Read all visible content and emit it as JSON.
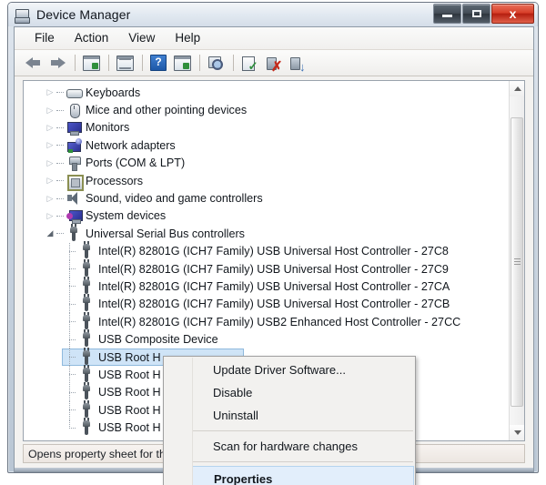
{
  "window": {
    "title": "Device Manager",
    "icon": "device-manager-icon",
    "buttons": {
      "minimize": "–",
      "maximize": "□",
      "close": "x"
    }
  },
  "menubar": {
    "items": [
      {
        "label": "File"
      },
      {
        "label": "Action"
      },
      {
        "label": "View"
      },
      {
        "label": "Help"
      }
    ]
  },
  "toolbar": {
    "items": [
      {
        "name": "back-icon",
        "type": "arrow-left"
      },
      {
        "name": "forward-icon",
        "type": "arrow-right"
      },
      {
        "name": "separator-1",
        "type": "separator"
      },
      {
        "name": "show-hidden-devices-icon",
        "type": "panel-green"
      },
      {
        "name": "separator-2",
        "type": "separator"
      },
      {
        "name": "properties-icon",
        "type": "panel-lines"
      },
      {
        "name": "separator-3",
        "type": "separator"
      },
      {
        "name": "help-icon",
        "type": "help",
        "glyph": "?"
      },
      {
        "name": "view-panel-icon",
        "type": "panel-green2"
      },
      {
        "name": "separator-4",
        "type": "separator"
      },
      {
        "name": "scan-for-hardware-changes-icon",
        "type": "scan"
      },
      {
        "name": "separator-5",
        "type": "separator"
      },
      {
        "name": "update-driver-icon",
        "type": "driver-check"
      },
      {
        "name": "disable-device-icon",
        "type": "driver-x"
      },
      {
        "name": "enable-device-icon",
        "type": "driver-down"
      }
    ]
  },
  "tree": {
    "nodes": [
      {
        "label": "Keyboards",
        "icon": "keyboard-icon",
        "level": 1,
        "expander": "collapsed"
      },
      {
        "label": "Mice and other pointing devices",
        "icon": "mouse-icon",
        "level": 1,
        "expander": "collapsed"
      },
      {
        "label": "Monitors",
        "icon": "monitor-icon",
        "level": 1,
        "expander": "collapsed"
      },
      {
        "label": "Network adapters",
        "icon": "network-adapter-icon",
        "level": 1,
        "expander": "collapsed"
      },
      {
        "label": "Ports (COM & LPT)",
        "icon": "port-icon",
        "level": 1,
        "expander": "collapsed"
      },
      {
        "label": "Processors",
        "icon": "processor-icon",
        "level": 1,
        "expander": "collapsed"
      },
      {
        "label": "Sound, video and game controllers",
        "icon": "sound-icon",
        "level": 1,
        "expander": "collapsed"
      },
      {
        "label": "System devices",
        "icon": "system-device-icon",
        "level": 1,
        "expander": "collapsed"
      },
      {
        "label": "Universal Serial Bus controllers",
        "icon": "usb-icon",
        "level": 1,
        "expander": "expanded"
      },
      {
        "label": "Intel(R) 82801G (ICH7 Family) USB Universal Host Controller - 27C8",
        "icon": "usb-icon",
        "level": 2,
        "expander": "none"
      },
      {
        "label": "Intel(R) 82801G (ICH7 Family) USB Universal Host Controller - 27C9",
        "icon": "usb-icon",
        "level": 2,
        "expander": "none"
      },
      {
        "label": "Intel(R) 82801G (ICH7 Family) USB Universal Host Controller - 27CA",
        "icon": "usb-icon",
        "level": 2,
        "expander": "none"
      },
      {
        "label": "Intel(R) 82801G (ICH7 Family) USB Universal Host Controller - 27CB",
        "icon": "usb-icon",
        "level": 2,
        "expander": "none"
      },
      {
        "label": "Intel(R) 82801G (ICH7 Family) USB2 Enhanced Host Controller - 27CC",
        "icon": "usb-icon",
        "level": 2,
        "expander": "none"
      },
      {
        "label": "USB Composite Device",
        "icon": "usb-icon",
        "level": 2,
        "expander": "none"
      },
      {
        "label": "USB Root H",
        "icon": "usb-icon",
        "level": 2,
        "expander": "none",
        "selected": true
      },
      {
        "label": "USB Root H",
        "icon": "usb-icon",
        "level": 2,
        "expander": "none"
      },
      {
        "label": "USB Root H",
        "icon": "usb-icon",
        "level": 2,
        "expander": "none"
      },
      {
        "label": "USB Root H",
        "icon": "usb-icon",
        "level": 2,
        "expander": "none"
      },
      {
        "label": "USB Root H",
        "icon": "usb-icon",
        "level": 2,
        "expander": "none"
      }
    ]
  },
  "context_menu": {
    "items": [
      {
        "label": "Update Driver Software...",
        "highlighted": false,
        "type": "item"
      },
      {
        "label": "Disable",
        "highlighted": false,
        "type": "item"
      },
      {
        "label": "Uninstall",
        "highlighted": false,
        "type": "item"
      },
      {
        "type": "separator"
      },
      {
        "label": "Scan for hardware changes",
        "highlighted": false,
        "type": "item"
      },
      {
        "type": "separator"
      },
      {
        "label": "Properties",
        "highlighted": true,
        "type": "item"
      }
    ]
  },
  "statusbar": {
    "text": "Opens property sheet for th"
  },
  "scrollbar": {
    "up_arrow": "scroll-up",
    "down_arrow": "scroll-down"
  },
  "colors": {
    "selection": "#cfe4f7",
    "menu_highlight": "#e2eefb",
    "close_button": "#d8402a",
    "help_icon": "#1d58a8"
  }
}
